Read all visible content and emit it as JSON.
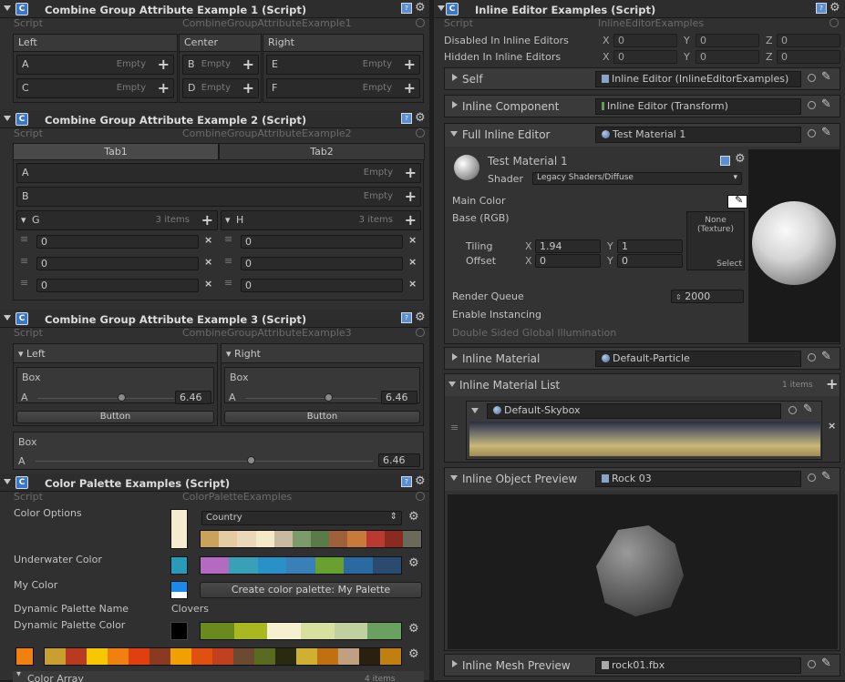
{
  "left": {
    "ex1": {
      "title": "Combine Group Attribute Example 1 (Script)",
      "script_label": "Script",
      "script_obj": "CombineGroupAttributeExample1",
      "cols": [
        "Left",
        "Center",
        "Right"
      ],
      "fields": [
        {
          "name": "A",
          "val": "Empty"
        },
        {
          "name": "C",
          "val": "Empty"
        },
        {
          "name": "B",
          "val": "Empty"
        },
        {
          "name": "D",
          "val": "Empty"
        },
        {
          "name": "E",
          "val": "Empty"
        },
        {
          "name": "F",
          "val": "Empty"
        }
      ]
    },
    "ex2": {
      "title": "Combine Group Attribute Example 2 (Script)",
      "script_label": "Script",
      "script_obj": "CombineGroupAttributeExample2",
      "tabs": [
        "Tab1",
        "Tab2"
      ],
      "a": "A",
      "b": "B",
      "empty": "Empty",
      "g": "G",
      "h": "H",
      "items": "3 items",
      "list_vals": [
        "0",
        "0",
        "0"
      ]
    },
    "ex3": {
      "title": "Combine Group Attribute Example 3 (Script)",
      "script_label": "Script",
      "script_obj": "CombineGroupAttributeExample3",
      "left": "Left",
      "right": "Right",
      "box": "Box",
      "a": "A",
      "val": "6.46",
      "button": "Button",
      "slider_frac": 0.6
    },
    "pal": {
      "title": "Color Palette Examples (Script)",
      "script_label": "Script",
      "script_obj": "ColorPaletteExamples",
      "color_options": "Color Options",
      "country": "Country",
      "underwater": "Underwater Color",
      "my_color": "My Color",
      "create_btn": "Create color palette: My Palette",
      "dyn_name_label": "Dynamic Palette Name",
      "dyn_name_val": "Clovers",
      "dyn_color": "Dynamic Palette Color",
      "color_array": "Color Array",
      "color_array_count": "4 items",
      "country_colors": [
        "#c9a35a",
        "#e4cba3",
        "#ead8b8",
        "#f5e8c8",
        "#c9b9a0",
        "#7c9a6a",
        "#5a7a4a",
        "#a0603a",
        "#c97a3a",
        "#b83a30",
        "#8a2a20",
        "#6a6a5a"
      ],
      "under_colors": [
        "#b46ac0",
        "#3aa0b8",
        "#2a90c8",
        "#3a80b8",
        "#6aa030",
        "#2a6aa0",
        "#2a4a70"
      ],
      "clover_colors": [
        "#6a8a20",
        "#a8b820",
        "#f5f0d0",
        "#d8e0a0",
        "#c0d0a0",
        "#6aa060"
      ],
      "array_colors": [
        "#c9a030",
        "#b83a20",
        "#f5c800",
        "#f08010",
        "#e04010",
        "#8a3a20",
        "#f0a000",
        "#e05010",
        "#c04020",
        "#6a4a30",
        "#5a6a20",
        "#2a2a10",
        "#d0b030",
        "#c07010",
        "#c0a080",
        "#2a2010",
        "#c08010"
      ]
    }
  },
  "right": {
    "title": "Inline Editor Examples (Script)",
    "script_label": "Script",
    "script_obj": "InlineEditorExamples",
    "disabled": "Disabled In Inline Editors",
    "hidden": "Hidden In Inline Editors",
    "xyz": [
      "X",
      "Y",
      "Z"
    ],
    "vec_vals": [
      "0",
      "0",
      "0"
    ],
    "self": {
      "label": "Self",
      "obj": "Inline Editor (InlineEditorExamples)"
    },
    "comp": {
      "label": "Inline Component",
      "obj": "Inline Editor (Transform)"
    },
    "full": {
      "label": "Full Inline Editor",
      "obj": "Test Material 1"
    },
    "mat": {
      "name": "Test Material 1",
      "shader_label": "Shader",
      "shader": "Legacy Shaders/Diffuse",
      "main_color": "Main Color",
      "base": "Base (RGB)",
      "none": "None",
      "texture": "(Texture)",
      "select": "Select",
      "tiling": "Tiling",
      "offset": "Offset",
      "tx": "1.94",
      "ty": "1",
      "ox": "0",
      "oy": "0",
      "rq_label": "Render Queue",
      "rq": "2000",
      "instancing": "Enable Instancing",
      "dsgi": "Double Sided Global Illumination"
    },
    "imat": {
      "label": "Inline Material",
      "obj": "Default-Particle"
    },
    "ilist": {
      "label": "Inline Material List",
      "count": "1 items",
      "item": "Default-Skybox"
    },
    "iprev": {
      "label": "Inline Object Preview",
      "obj": "Rock 03"
    },
    "imesh": {
      "label": "Inline Mesh Preview",
      "obj": "rock01.fbx"
    }
  }
}
